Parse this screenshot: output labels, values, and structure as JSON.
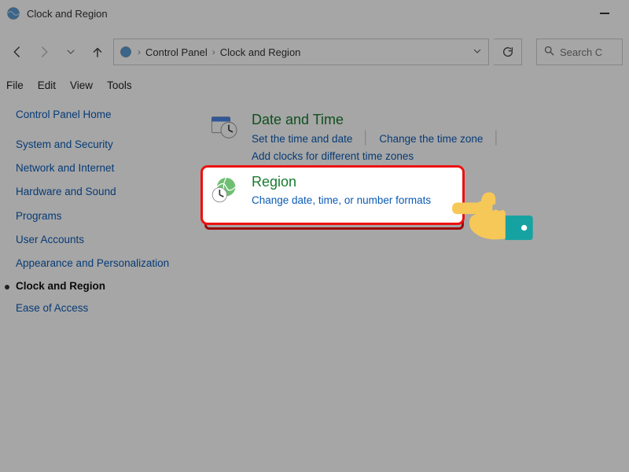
{
  "titlebar": {
    "title": "Clock and Region"
  },
  "address": {
    "seg1": "Control Panel",
    "seg2": "Clock and Region"
  },
  "search": {
    "placeholder": "Search C"
  },
  "menu": {
    "file": "File",
    "edit": "Edit",
    "view": "View",
    "tools": "Tools"
  },
  "sidebar": {
    "home": "Control Panel Home",
    "items": [
      "System and Security",
      "Network and Internet",
      "Hardware and Sound",
      "Programs",
      "User Accounts",
      "Appearance and Personalization",
      "Clock and Region",
      "Ease of Access"
    ]
  },
  "main": {
    "dateTime": {
      "title": "Date and Time",
      "links": [
        "Set the time and date",
        "Change the time zone",
        "Add clocks for different time zones"
      ]
    },
    "region": {
      "title": "Region",
      "links": [
        "Change date, time, or number formats"
      ]
    }
  }
}
